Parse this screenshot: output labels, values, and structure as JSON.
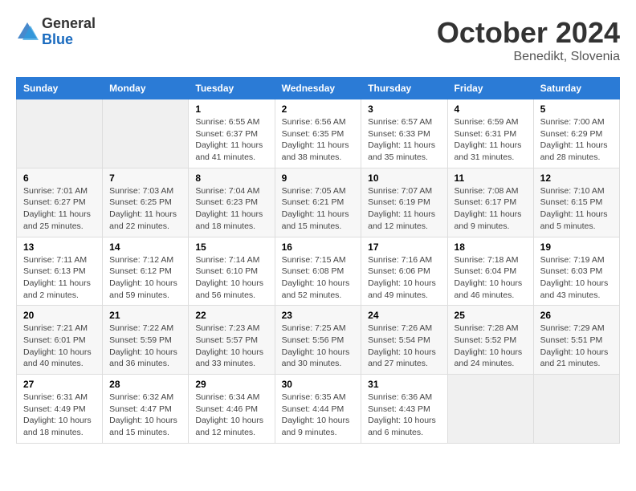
{
  "header": {
    "logo_general": "General",
    "logo_blue": "Blue",
    "month_title": "October 2024",
    "location": "Benedikt, Slovenia"
  },
  "weekdays": [
    "Sunday",
    "Monday",
    "Tuesday",
    "Wednesday",
    "Thursday",
    "Friday",
    "Saturday"
  ],
  "weeks": [
    [
      null,
      null,
      {
        "day": 1,
        "sunrise": "6:55 AM",
        "sunset": "6:37 PM",
        "daylight": "11 hours and 41 minutes."
      },
      {
        "day": 2,
        "sunrise": "6:56 AM",
        "sunset": "6:35 PM",
        "daylight": "11 hours and 38 minutes."
      },
      {
        "day": 3,
        "sunrise": "6:57 AM",
        "sunset": "6:33 PM",
        "daylight": "11 hours and 35 minutes."
      },
      {
        "day": 4,
        "sunrise": "6:59 AM",
        "sunset": "6:31 PM",
        "daylight": "11 hours and 31 minutes."
      },
      {
        "day": 5,
        "sunrise": "7:00 AM",
        "sunset": "6:29 PM",
        "daylight": "11 hours and 28 minutes."
      }
    ],
    [
      {
        "day": 6,
        "sunrise": "7:01 AM",
        "sunset": "6:27 PM",
        "daylight": "11 hours and 25 minutes."
      },
      {
        "day": 7,
        "sunrise": "7:03 AM",
        "sunset": "6:25 PM",
        "daylight": "11 hours and 22 minutes."
      },
      {
        "day": 8,
        "sunrise": "7:04 AM",
        "sunset": "6:23 PM",
        "daylight": "11 hours and 18 minutes."
      },
      {
        "day": 9,
        "sunrise": "7:05 AM",
        "sunset": "6:21 PM",
        "daylight": "11 hours and 15 minutes."
      },
      {
        "day": 10,
        "sunrise": "7:07 AM",
        "sunset": "6:19 PM",
        "daylight": "11 hours and 12 minutes."
      },
      {
        "day": 11,
        "sunrise": "7:08 AM",
        "sunset": "6:17 PM",
        "daylight": "11 hours and 9 minutes."
      },
      {
        "day": 12,
        "sunrise": "7:10 AM",
        "sunset": "6:15 PM",
        "daylight": "11 hours and 5 minutes."
      }
    ],
    [
      {
        "day": 13,
        "sunrise": "7:11 AM",
        "sunset": "6:13 PM",
        "daylight": "11 hours and 2 minutes."
      },
      {
        "day": 14,
        "sunrise": "7:12 AM",
        "sunset": "6:12 PM",
        "daylight": "10 hours and 59 minutes."
      },
      {
        "day": 15,
        "sunrise": "7:14 AM",
        "sunset": "6:10 PM",
        "daylight": "10 hours and 56 minutes."
      },
      {
        "day": 16,
        "sunrise": "7:15 AM",
        "sunset": "6:08 PM",
        "daylight": "10 hours and 52 minutes."
      },
      {
        "day": 17,
        "sunrise": "7:16 AM",
        "sunset": "6:06 PM",
        "daylight": "10 hours and 49 minutes."
      },
      {
        "day": 18,
        "sunrise": "7:18 AM",
        "sunset": "6:04 PM",
        "daylight": "10 hours and 46 minutes."
      },
      {
        "day": 19,
        "sunrise": "7:19 AM",
        "sunset": "6:03 PM",
        "daylight": "10 hours and 43 minutes."
      }
    ],
    [
      {
        "day": 20,
        "sunrise": "7:21 AM",
        "sunset": "6:01 PM",
        "daylight": "10 hours and 40 minutes."
      },
      {
        "day": 21,
        "sunrise": "7:22 AM",
        "sunset": "5:59 PM",
        "daylight": "10 hours and 36 minutes."
      },
      {
        "day": 22,
        "sunrise": "7:23 AM",
        "sunset": "5:57 PM",
        "daylight": "10 hours and 33 minutes."
      },
      {
        "day": 23,
        "sunrise": "7:25 AM",
        "sunset": "5:56 PM",
        "daylight": "10 hours and 30 minutes."
      },
      {
        "day": 24,
        "sunrise": "7:26 AM",
        "sunset": "5:54 PM",
        "daylight": "10 hours and 27 minutes."
      },
      {
        "day": 25,
        "sunrise": "7:28 AM",
        "sunset": "5:52 PM",
        "daylight": "10 hours and 24 minutes."
      },
      {
        "day": 26,
        "sunrise": "7:29 AM",
        "sunset": "5:51 PM",
        "daylight": "10 hours and 21 minutes."
      }
    ],
    [
      {
        "day": 27,
        "sunrise": "6:31 AM",
        "sunset": "4:49 PM",
        "daylight": "10 hours and 18 minutes."
      },
      {
        "day": 28,
        "sunrise": "6:32 AM",
        "sunset": "4:47 PM",
        "daylight": "10 hours and 15 minutes."
      },
      {
        "day": 29,
        "sunrise": "6:34 AM",
        "sunset": "4:46 PM",
        "daylight": "10 hours and 12 minutes."
      },
      {
        "day": 30,
        "sunrise": "6:35 AM",
        "sunset": "4:44 PM",
        "daylight": "10 hours and 9 minutes."
      },
      {
        "day": 31,
        "sunrise": "6:36 AM",
        "sunset": "4:43 PM",
        "daylight": "10 hours and 6 minutes."
      },
      null,
      null
    ]
  ]
}
